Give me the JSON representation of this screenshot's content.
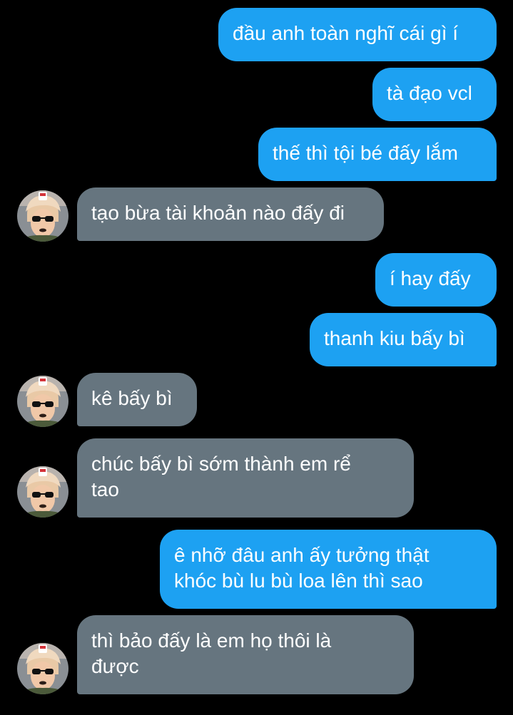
{
  "conversation": {
    "messages": [
      {
        "side": "sent",
        "text": "đầu anh toàn nghĩ cái gì í"
      },
      {
        "side": "sent",
        "text": "tà đạo vcl"
      },
      {
        "side": "sent",
        "text": "thế thì tội bé đấy lắm"
      },
      {
        "side": "received",
        "text": "tạo bừa tài khoản nào đấy đi"
      },
      {
        "side": "sent",
        "text": "í hay đấy"
      },
      {
        "side": "sent",
        "text": "thanh kiu bấy bì"
      },
      {
        "side": "received",
        "text": "kê bấy bì"
      },
      {
        "side": "received",
        "lines": [
          "chúc bấy bì sớm thành em rể",
          "tao"
        ]
      },
      {
        "side": "sent",
        "lines": [
          "ê nhỡ đâu anh ấy tưởng thật",
          "khóc bù lu bù loa lên thì sao"
        ]
      },
      {
        "side": "received",
        "lines": [
          "thì bảo đấy là em họ thôi là",
          "được"
        ]
      }
    ]
  },
  "theme": {
    "background": "#000000",
    "sent_bubble": "#1da1f2",
    "received_bubble": "#66757f",
    "text": "#ffffff"
  },
  "contact": {
    "avatar_icon": "avatar-photo-icon"
  }
}
